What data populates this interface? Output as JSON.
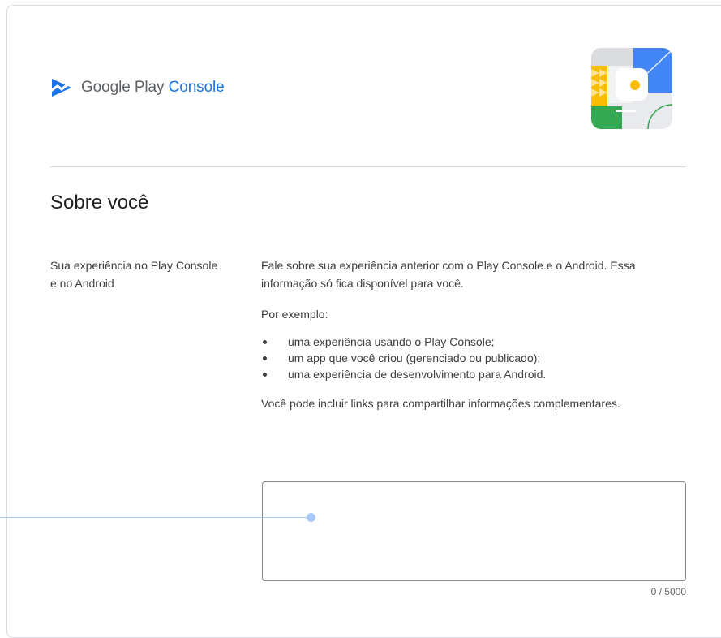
{
  "header": {
    "brand_prefix": "Google Play",
    "brand_suffix": "Console",
    "logo_icon": "play-console-logo-icon",
    "illustration_icon": "account-illustration-icon"
  },
  "section": {
    "title": "Sobre você"
  },
  "field": {
    "label": "Sua experiência no Play Console e no Android",
    "description": "Fale sobre sua experiência anterior com o Play Console e o Android. Essa informação só fica disponível para você.",
    "example_label": "Por exemplo:",
    "examples": [
      "uma experiência usando o Play Console;",
      "um app que você criou (gerenciado ou publicado);",
      "uma experiência de desenvolvimento para Android."
    ],
    "links_note": "Você pode incluir links para compartilhar informações complementares.",
    "value": "",
    "counter": "0 / 5000"
  },
  "colors": {
    "accent": "#1a73e8",
    "callout": "#a8c7fa"
  }
}
